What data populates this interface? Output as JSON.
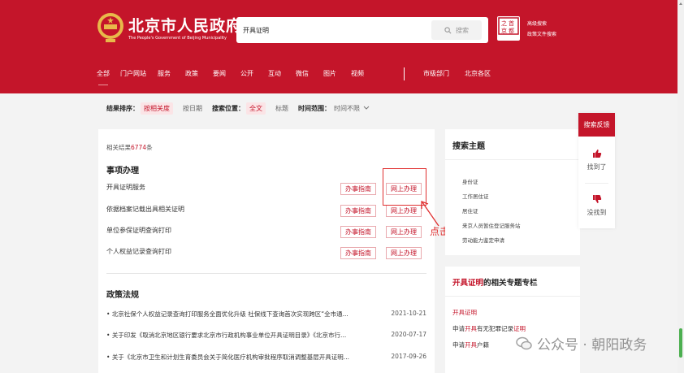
{
  "header": {
    "title_cn": "北京市人民政府",
    "title_en": "The People's Government of Beijing Municipality",
    "search_value": "开具证明",
    "search_button": "搜索",
    "adv_link1": "高级搜索",
    "adv_link2": "政策文件搜索",
    "nav": [
      "全部",
      "门户网站",
      "服务",
      "政策",
      "要闻",
      "公开",
      "互动",
      "微信",
      "图片",
      "视频"
    ],
    "nav2": [
      "市级部门",
      "北京各区"
    ]
  },
  "filter": {
    "sort_label": "结果排序：",
    "sort_active": "按相关度",
    "sort_other": "按日期",
    "pos_label": "搜索位置：",
    "pos_active": "全文",
    "pos_other": "标题",
    "time_label": "时间范围：",
    "time_value": "时间不限"
  },
  "results": {
    "count_prefix": "相关结果",
    "count": "6774",
    "count_suffix": "条",
    "section1_title": "事项办理",
    "items": [
      {
        "name": "开具证明服务",
        "btn1": "办事指南",
        "btn2": "网上办理"
      },
      {
        "name": "依据档案记载出具相关证明",
        "btn1": "办事指南",
        "btn2": "网上办理"
      },
      {
        "name": "单位参保证明查询打印",
        "btn1": "办事指南",
        "btn2": "网上办理"
      },
      {
        "name": "个人权益记录查询打印",
        "btn1": "办事指南",
        "btn2": "网上办理"
      }
    ],
    "annotation": "点击",
    "section2_title": "政策法规",
    "policies": [
      {
        "title": "北京社保个人权益记录查询打印服务全面优化升级 社保线下查询首次实现跨区“全市通...",
        "date": "2021-10-21"
      },
      {
        "title": "关于印发《取消北京地区银行要求北京市行政机构事业单位开具证明目录》《北京市行...",
        "date": "2020-07-17"
      },
      {
        "title": "关于《北京市卫生和计划生育委员会关于简化医疗机构审批程序取消调整基层开具证明...",
        "date": "2017-09-26"
      }
    ]
  },
  "side": {
    "theme_title": "搜索主题",
    "themes": [
      "身份证",
      "工作居住证",
      "居住证",
      "来京人员暂住登记服务站",
      "劳动能力鉴定申请"
    ],
    "topic_highlight": "开具证明",
    "topic_rest": "的相关专题专栏",
    "topics": [
      {
        "pre": "",
        "hl": "开具证明",
        "post": ""
      },
      {
        "pre": "申请",
        "hl": "开具",
        "post": "有无犯罪记录"
      },
      {
        "pre": "申请",
        "hl": "开具",
        "post": "户籍"
      }
    ],
    "topic2_tail": "证明"
  },
  "feedback": {
    "title": "搜索反馈",
    "found": "找到了",
    "not_found": "没找到"
  },
  "watermark": "公众号 · 朝阳政务",
  "colors": {
    "brand": "#c4152a"
  }
}
